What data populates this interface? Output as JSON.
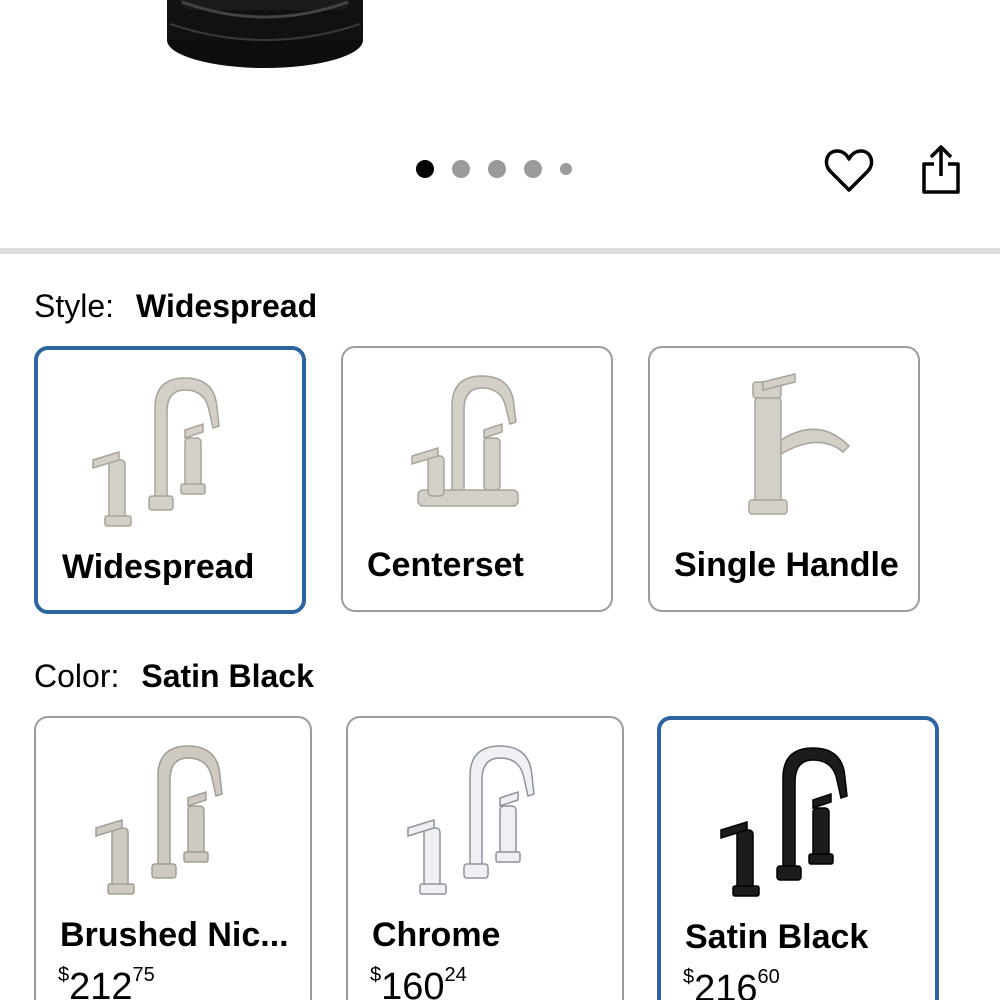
{
  "gallery": {
    "dots": [
      true,
      false,
      false,
      false,
      false
    ],
    "favorite_icon": "heart-icon",
    "share_icon": "share-icon"
  },
  "style": {
    "key": "Style:",
    "value": "Widespread",
    "options": [
      {
        "label": "Widespread",
        "selected": true,
        "finish": "nickel"
      },
      {
        "label": "Centerset",
        "selected": false,
        "finish": "nickel"
      },
      {
        "label": "Single Handle",
        "selected": false,
        "finish": "nickel"
      }
    ]
  },
  "color": {
    "key": "Color:",
    "value": "Satin Black",
    "options": [
      {
        "label": "Brushed Nic...",
        "currency": "$",
        "dollars": "212",
        "cents": "75",
        "selected": false,
        "finish": "#c9c5bd"
      },
      {
        "label": "Chrome",
        "currency": "$",
        "dollars": "160",
        "cents": "24",
        "selected": false,
        "finish": "#e4e6ea"
      },
      {
        "label": "Satin Black",
        "currency": "$",
        "dollars": "216",
        "cents": "60",
        "selected": true,
        "finish": "#1a1a1a"
      }
    ]
  },
  "colors": {
    "accent": "#2e64a0",
    "border": "#9c9c9c",
    "divider": "#dcdcdc"
  }
}
